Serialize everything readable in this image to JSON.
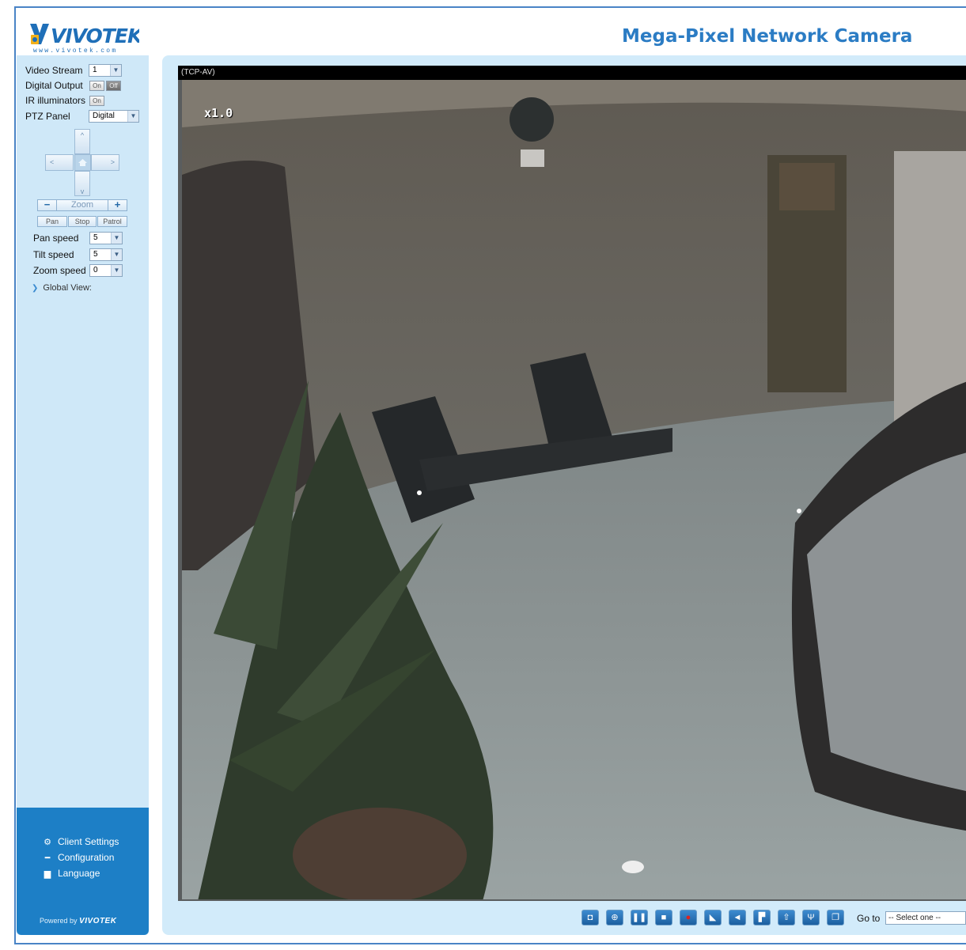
{
  "header": {
    "logo_text": "VIVOTEK",
    "logo_url": "www.vivotek.com",
    "title": "Mega-Pixel Network Camera"
  },
  "sidebar": {
    "video_stream": {
      "label": "Video Stream",
      "value": "1"
    },
    "digital_output": {
      "label": "Digital Output",
      "on": "On",
      "off": "Off"
    },
    "ir_illuminators": {
      "label": "IR illuminators",
      "on": "On"
    },
    "ptz_panel": {
      "label": "PTZ Panel",
      "value": "Digital"
    },
    "zoom": {
      "minus": "−",
      "label": "Zoom",
      "plus": "+"
    },
    "modes": {
      "pan": "Pan",
      "stop": "Stop",
      "patrol": "Patrol"
    },
    "pan_speed": {
      "label": "Pan speed",
      "value": "5"
    },
    "tilt_speed": {
      "label": "Tilt speed",
      "value": "5"
    },
    "zoom_speed": {
      "label": "Zoom speed",
      "value": "0"
    },
    "global_view": "Global View:",
    "menu": [
      {
        "label": "Client Settings",
        "icon": "gear-icon"
      },
      {
        "label": "Configuration",
        "icon": "wrench-icon"
      },
      {
        "label": "Language",
        "icon": "speech-bubble-icon"
      }
    ],
    "powered_by": "Powered by",
    "powered_brand": "VIVOTEK"
  },
  "video": {
    "protocol": "(TCP-AV)",
    "zoom_level": "x1.0"
  },
  "toolbar": {
    "icons": [
      "snapshot-icon",
      "digital-zoom-icon",
      "pause-icon",
      "stop-icon",
      "record-icon",
      "volume-icon",
      "speaker-icon",
      "talk-icon",
      "upload-icon",
      "microphone-icon",
      "fullscreen-icon"
    ],
    "goto_label": "Go to",
    "goto_select": "-- Select one --"
  },
  "colors": {
    "accent": "#2b7cc4",
    "sidebar_bg": "#cfe8f8",
    "sidebar_menu_bg": "#1d7fc6",
    "panel_bg": "#d2ebfa"
  }
}
